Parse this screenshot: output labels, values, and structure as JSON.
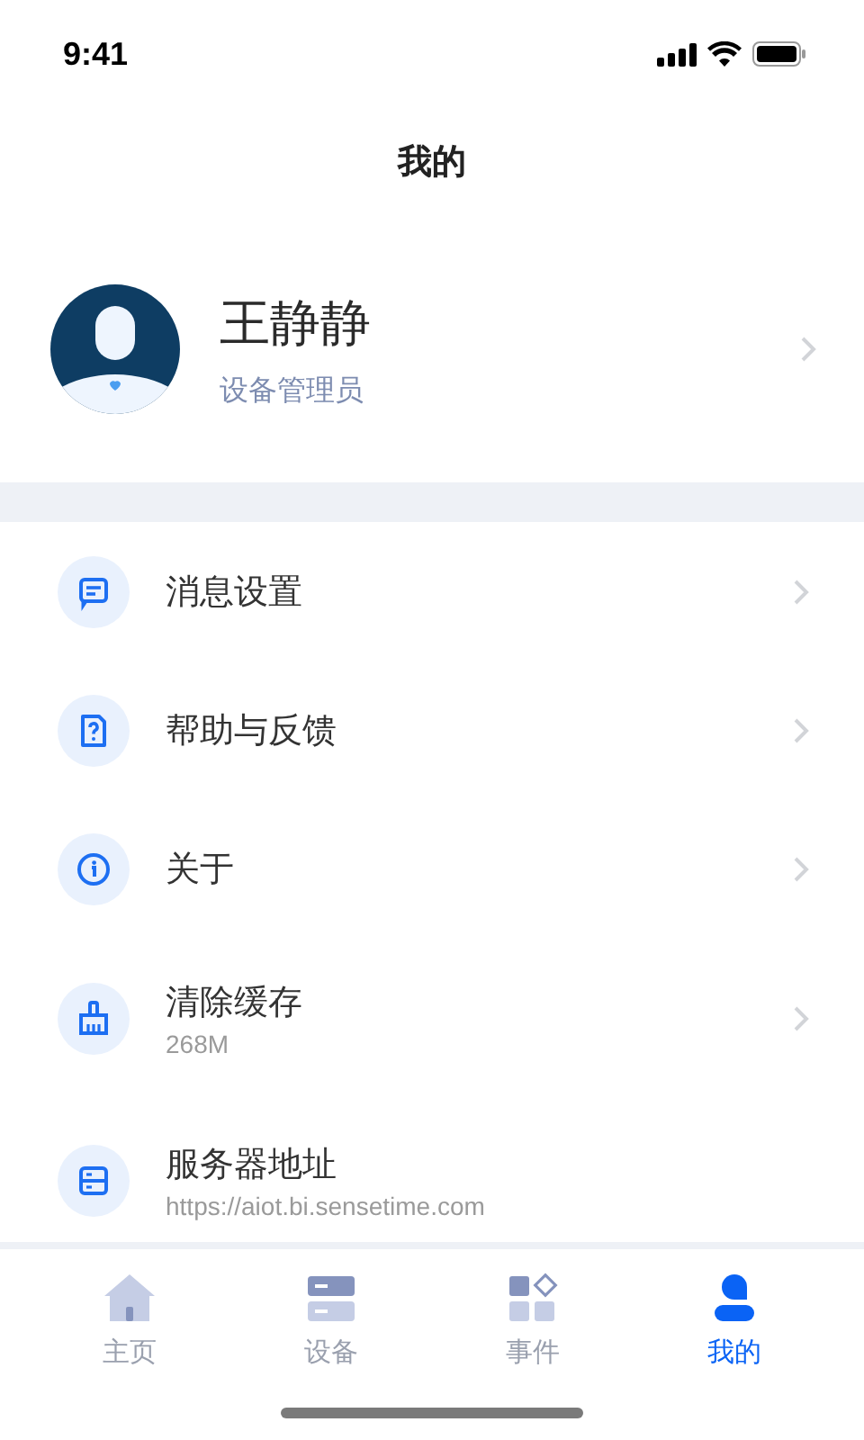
{
  "status_bar": {
    "time": "9:41"
  },
  "header": {
    "title": "我的"
  },
  "profile": {
    "name": "王静静",
    "role": "设备管理员"
  },
  "menu": [
    {
      "kind": "link",
      "label": "消息设置"
    },
    {
      "kind": "link",
      "label": "帮助与反馈"
    },
    {
      "kind": "link",
      "label": "关于"
    },
    {
      "kind": "link",
      "label": "清除缓存",
      "detail": "268M"
    },
    {
      "kind": "value",
      "label": "服务器地址",
      "detail": "https://aiot.bi.sensetime.com"
    }
  ],
  "tab_bar": [
    {
      "label": "主页",
      "selected": false
    },
    {
      "label": "设备",
      "selected": false
    },
    {
      "label": "事件",
      "selected": false
    },
    {
      "label": "我的",
      "selected": true
    }
  ]
}
